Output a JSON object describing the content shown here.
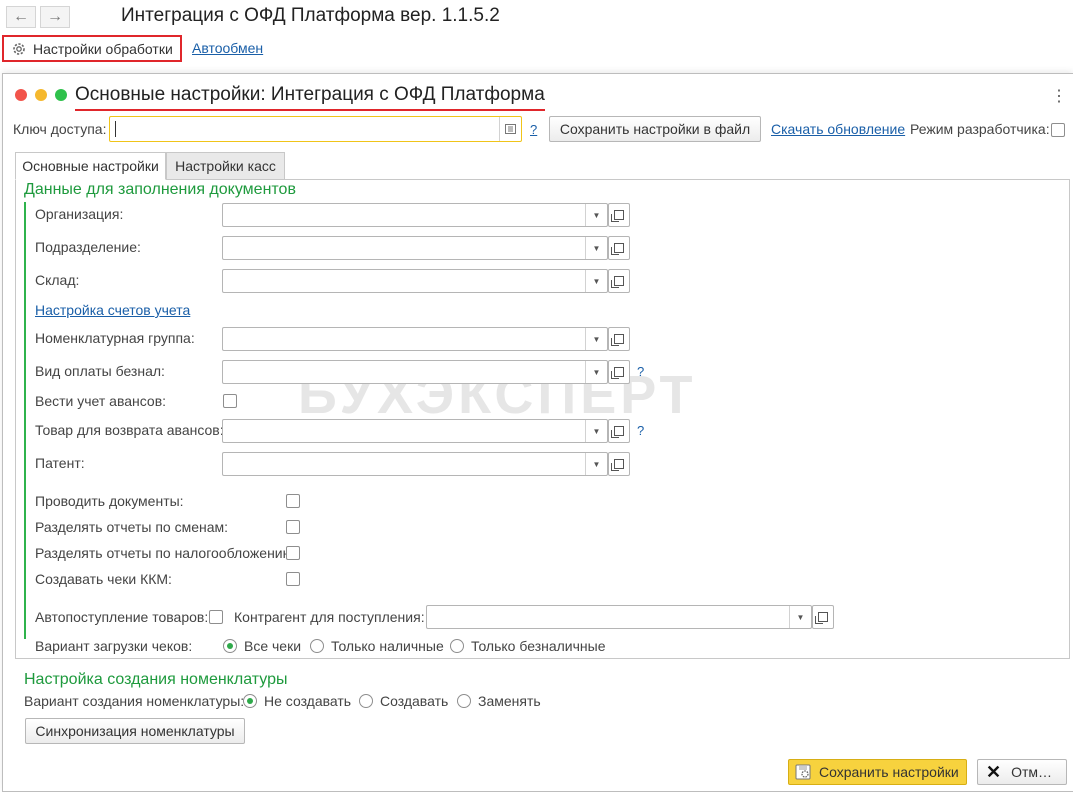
{
  "app": {
    "title": "Интеграция с ОФД Платформа вер. 1.1.5.2",
    "back_icon": "arrow-left-icon",
    "forward_icon": "arrow-right-icon",
    "settings_button": "Настройки обработки",
    "autoexchange_link": "Автообмен"
  },
  "dialog": {
    "title": "Основные настройки: Интеграция с ОФД Платформа",
    "access_key_label": "Ключ доступа:",
    "access_key_value": "",
    "help": "?",
    "save_to_file_button": "Сохранить настройки в файл",
    "download_update_link": "Скачать обновление",
    "dev_mode_label": "Режим разработчика:",
    "tabs": [
      "Основные настройки",
      "Настройки касс"
    ],
    "active_tab": 0,
    "doc_group_title": "Данные для заполнения документов",
    "fields": {
      "organization": "Организация:",
      "department": "Подразделение:",
      "warehouse": "Склад:",
      "accounts_link": "Настройка счетов учета",
      "nomenclature_group": "Номенклатурная группа:",
      "cashless_payment": "Вид оплаты безнал:",
      "track_advances": "Вести учет авансов:",
      "advance_return_item": "Товар для возврата авансов:",
      "patent": "Патент:"
    },
    "checks": {
      "post_documents": "Проводить документы:",
      "split_by_shift": "Разделять отчеты по сменам:",
      "split_by_taxation": "Разделять отчеты по налогообложению:",
      "create_kkm_checks": "Создавать чеки ККМ:"
    },
    "auto_receipt_label": "Автопоступление товаров:",
    "counterparty_label": "Контрагент для поступления:",
    "check_load_label": "Вариант загрузки чеков:",
    "check_load_options": [
      "Все чеки",
      "Только наличные",
      "Только безналичные"
    ],
    "check_load_selected": "Все чеки",
    "nom_group_title": "Настройка создания номенклатуры",
    "nom_create_label": "Вариант создания номенклатуры:",
    "nom_create_options": [
      "Не создавать",
      "Создавать",
      "Заменять"
    ],
    "nom_create_selected": "Не создавать",
    "sync_button": "Синхронизация номенклатуры",
    "save_settings_button": "Сохранить настройки",
    "cancel_button": "Отм…"
  },
  "watermark": "БУХЭКСПЕРТ",
  "colors": {
    "accent_green": "#2fb34c",
    "highlight_red": "#e0262b",
    "primary_yellow": "#f7d23e",
    "link_blue": "#1a5fa8"
  }
}
